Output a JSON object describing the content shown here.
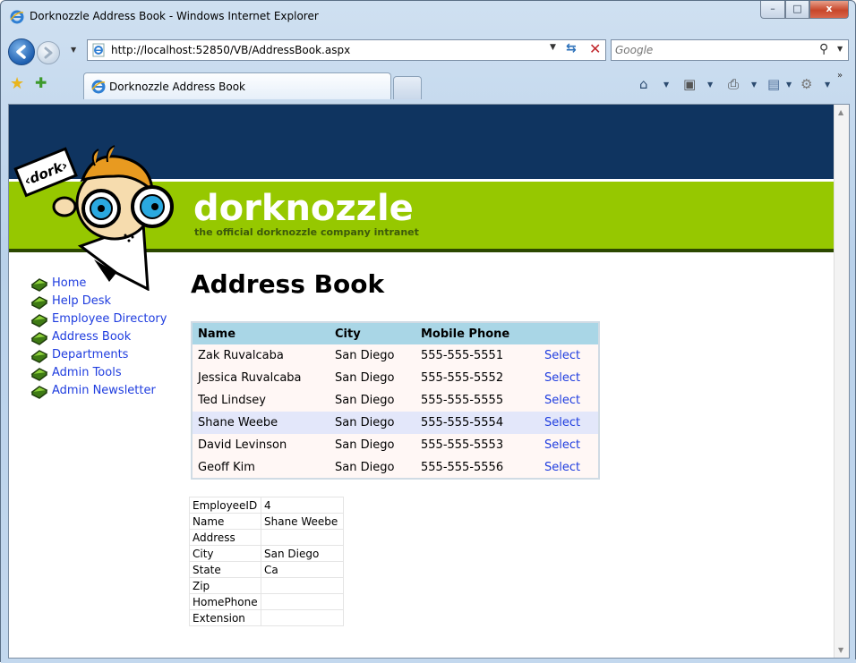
{
  "window": {
    "title": "Dorknozzle Address Book - Windows Internet Explorer",
    "minimize": "–",
    "maximize": "□",
    "close": "x"
  },
  "navbar": {
    "url": "http://localhost:52850/VB/AddressBook.aspx",
    "search_placeholder": "Google"
  },
  "tabs": [
    {
      "label": "Dorknozzle Address Book",
      "active": true
    }
  ],
  "header": {
    "logo_text": "‹dork›",
    "brand": "dorknozzle",
    "tagline": "the official dorknozzle company intranet"
  },
  "menu": [
    {
      "label": "Home"
    },
    {
      "label": "Help Desk"
    },
    {
      "label": "Employee Directory"
    },
    {
      "label": "Address Book"
    },
    {
      "label": "Departments"
    },
    {
      "label": "Admin Tools"
    },
    {
      "label": "Admin Newsletter"
    }
  ],
  "page_title": "Address Book",
  "grid": {
    "columns": [
      "Name",
      "City",
      "Mobile Phone",
      ""
    ],
    "select_label": "Select",
    "rows": [
      {
        "name": "Zak Ruvalcaba",
        "city": "San Diego",
        "phone": "555-555-5551"
      },
      {
        "name": "Jessica Ruvalcaba",
        "city": "San Diego",
        "phone": "555-555-5552"
      },
      {
        "name": "Ted Lindsey",
        "city": "San Diego",
        "phone": "555-555-5555"
      },
      {
        "name": "Shane Weebe",
        "city": "San Diego",
        "phone": "555-555-5554",
        "selected": true
      },
      {
        "name": "David Levinson",
        "city": "San Diego",
        "phone": "555-555-5553"
      },
      {
        "name": "Geoff Kim",
        "city": "San Diego",
        "phone": "555-555-5556"
      }
    ]
  },
  "details": [
    {
      "key": "EmployeeID",
      "value": "4"
    },
    {
      "key": "Name",
      "value": "Shane Weebe"
    },
    {
      "key": "Address",
      "value": ""
    },
    {
      "key": "City",
      "value": "San Diego"
    },
    {
      "key": "State",
      "value": "Ca"
    },
    {
      "key": "Zip",
      "value": ""
    },
    {
      "key": "HomePhone",
      "value": ""
    },
    {
      "key": "Extension",
      "value": ""
    }
  ],
  "colors": {
    "header_navy": "#0f3460",
    "header_green": "#96c800",
    "link_blue": "#1f3ddf",
    "grid_header": "#a9d6e6",
    "grid_selected": "#e3e7fa"
  }
}
